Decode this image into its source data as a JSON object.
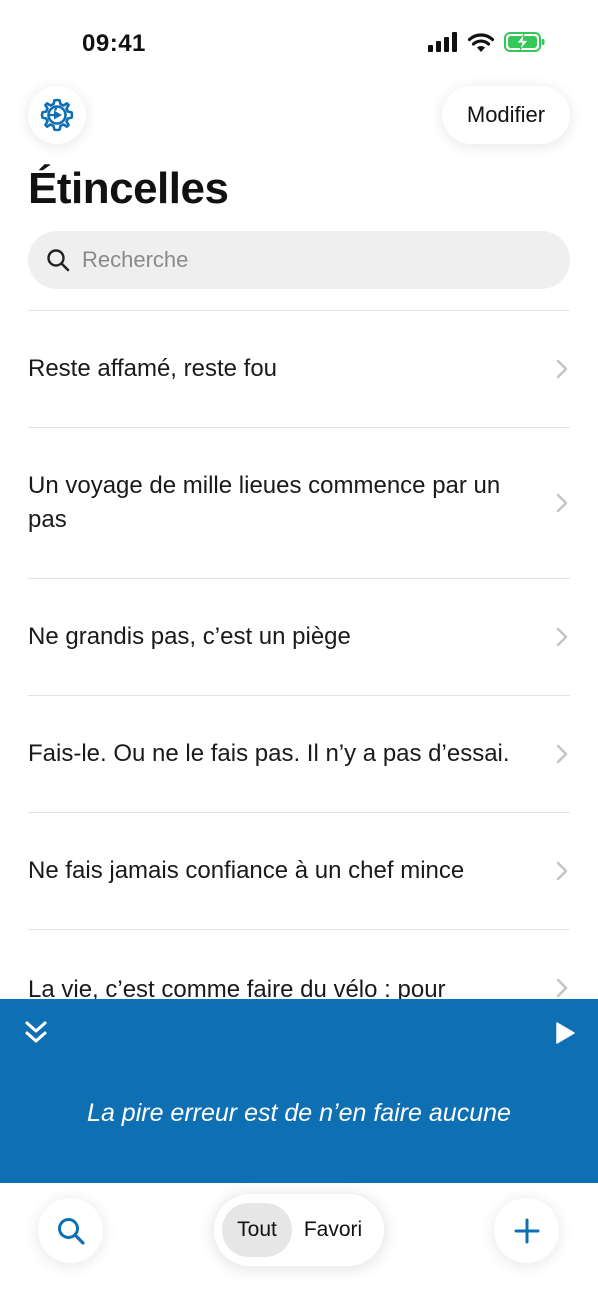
{
  "status_bar": {
    "time": "09:41",
    "icons": [
      "signal-icon",
      "wifi-icon",
      "battery-charging-icon"
    ]
  },
  "header": {
    "settings_icon": "gear-icon",
    "edit_label": "Modifier",
    "title": "Étincelles"
  },
  "search": {
    "placeholder": "Recherche",
    "value": ""
  },
  "quotes": [
    "Reste affamé, reste fou",
    "Un voyage de mille lieues commence par un pas",
    "Ne grandis pas, c’est un piège",
    "Fais-le. Ou ne le fais pas. Il n’y a pas d’essai.",
    "Ne fais jamais confiance à un chef mince",
    "La vie, c’est comme faire du vélo : pour"
  ],
  "now_playing": {
    "quote": "La pire erreur est de n’en faire aucune",
    "collapse_icon": "double-chevron-down-icon",
    "play_icon": "play-icon"
  },
  "bottom_bar": {
    "search_icon": "search-icon",
    "filter_all": "Tout",
    "filter_favorites": "Favori",
    "add_icon": "plus-icon"
  },
  "colors": {
    "accent": "#0f6fb3",
    "battery": "#34c759"
  }
}
